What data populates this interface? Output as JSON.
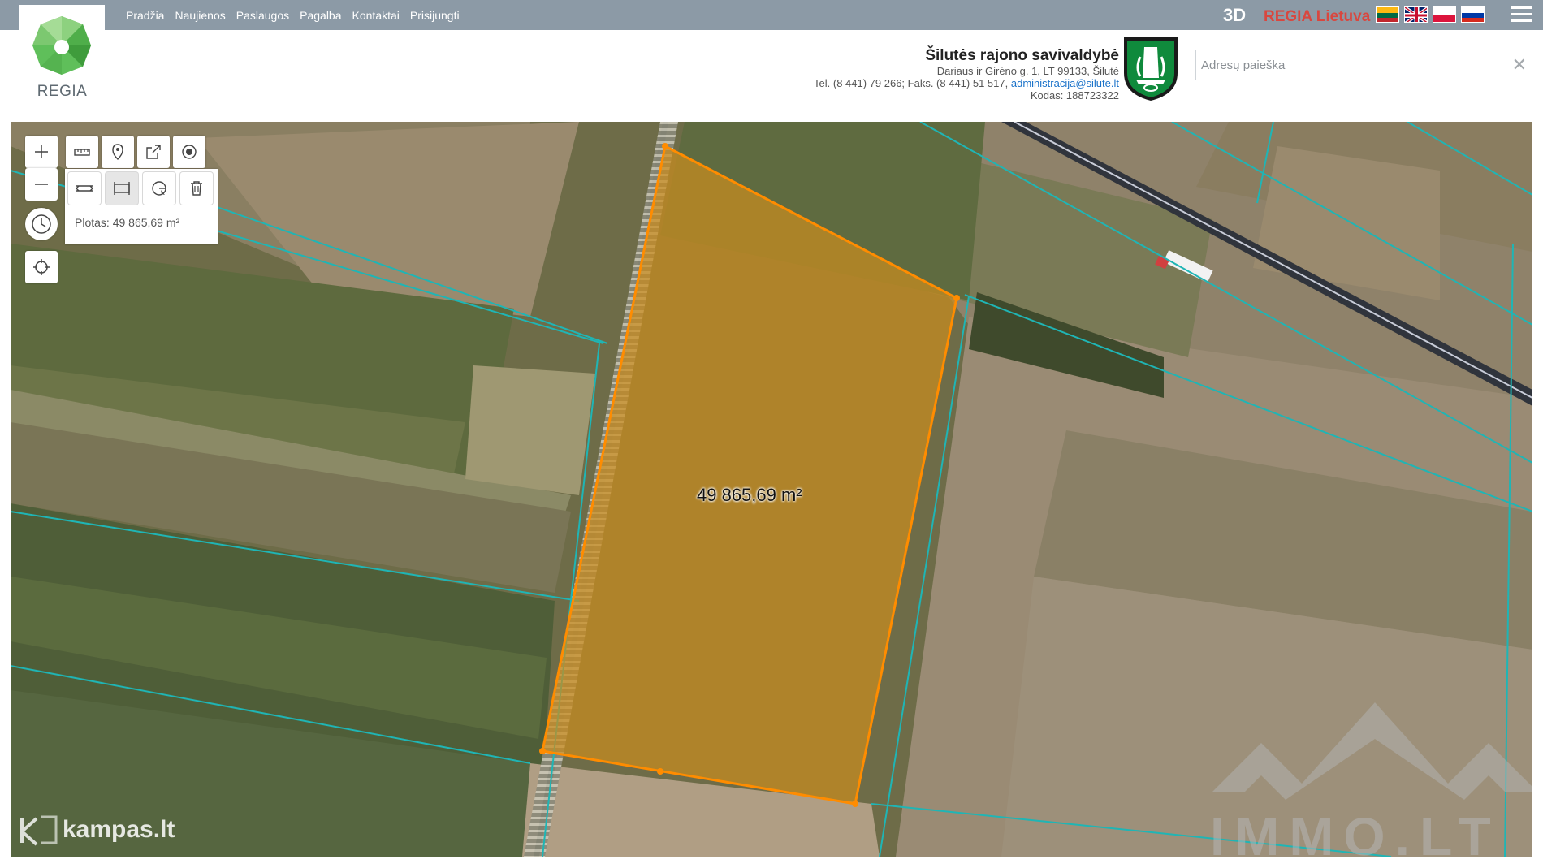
{
  "nav": {
    "items": [
      "Pradžia",
      "Naujienos",
      "Paslaugos",
      "Pagalba",
      "Kontaktai",
      "Prisijungti"
    ]
  },
  "logo": {
    "text": "REGIA"
  },
  "topright": {
    "btn_3d": "3D",
    "regia_lietuva": "REGIA Lietuva"
  },
  "municipality": {
    "name": "Šilutės rajono savivaldybė",
    "address": "Dariaus ir Girėno g. 1, LT 99133, Šilutė",
    "phones": "Tel. (8 441) 79 266; Faks. (8 441) 51 517,",
    "email": "administracija@silute.lt",
    "code": "Kodas: 188723322"
  },
  "search": {
    "placeholder": "Adresų paieška",
    "clear": "✕"
  },
  "measure": {
    "panel_label": "Plotas: 49 865,69 m²",
    "map_label": "49 865,69 m²"
  },
  "watermarks": {
    "immo": "IMMO.LT",
    "kampas": "kampas.lt"
  },
  "colors": {
    "topbar": "#8c9aa6",
    "accent_red": "#d9473f",
    "parcel_fill": "#c98c1e",
    "parcel_stroke": "#ff8c00",
    "cadastre_lines": "#1fb5b5"
  },
  "icons": [
    "zoom-in-icon",
    "zoom-out-icon",
    "history-icon",
    "locate-icon",
    "ruler-icon",
    "pin-icon",
    "share-icon",
    "record-icon",
    "measure-distance-icon",
    "measure-area-icon",
    "measure-radius-icon",
    "trash-icon"
  ]
}
